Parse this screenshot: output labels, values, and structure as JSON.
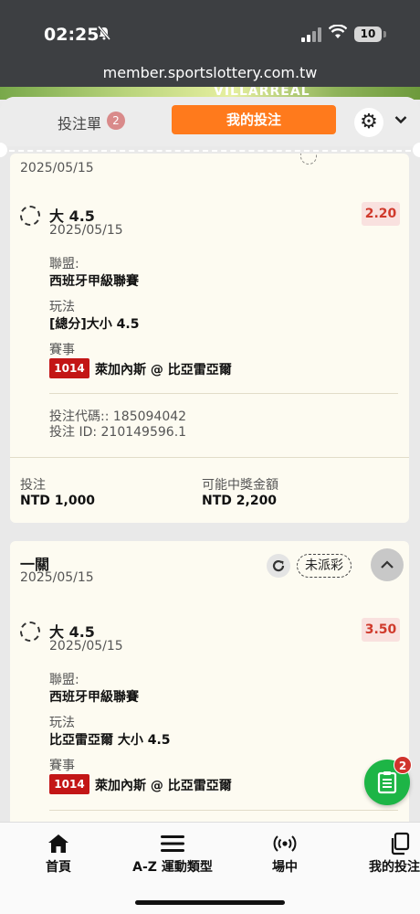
{
  "status_bar": {
    "time": "02:25",
    "battery": "10"
  },
  "url": "member.sportslottery.com.tw",
  "hero": {
    "team": "VILLARREAL"
  },
  "slip_header": {
    "slip_tab": "投注單",
    "slip_count": "2",
    "my_bets_tab": "我的投注"
  },
  "card1": {
    "date": "2025/05/15",
    "selection": "大 4.5",
    "selection_date": "2025/05/15",
    "odds": "2.20",
    "league_label": "聯盟:",
    "league": "西班牙甲級聯賽",
    "market_label": "玩法",
    "market": "[總分]大小 4.5",
    "event_label": "賽事",
    "event_code": "1014",
    "event": "萊加內斯 @ 比亞雷亞爾",
    "bet_code": "投注代碼:: 185094042",
    "bet_id": "投注 ID: 210149596.1",
    "stake_label": "投注",
    "stake": "NTD 1,000",
    "payout_label": "可能中獎金額",
    "payout": "NTD 2,200"
  },
  "card2": {
    "type": "一關",
    "date": "2025/05/15",
    "status": "未派彩",
    "selection": "大 4.5",
    "selection_date": "2025/05/15",
    "odds": "3.50",
    "league_label": "聯盟:",
    "league": "西班牙甲級聯賽",
    "market_label": "玩法",
    "market": "比亞雷亞爾 大小 4.5",
    "event_label": "賽事",
    "event_code": "1014",
    "event": "萊加內斯 @ 比亞雷亞爾"
  },
  "fab": {
    "badge": "2"
  },
  "bottom_nav": [
    {
      "label": "首頁",
      "icon": "home-icon"
    },
    {
      "label": "A-Z 運動類型",
      "icon": "menu-icon"
    },
    {
      "label": "場中",
      "icon": "live-icon"
    },
    {
      "label": "我的投注",
      "icon": "my-bets-icon"
    }
  ],
  "colors": {
    "accent": "#ff7a1c",
    "odds": "#d03a2c",
    "event_code": "#c31616",
    "fab": "#1db546"
  }
}
